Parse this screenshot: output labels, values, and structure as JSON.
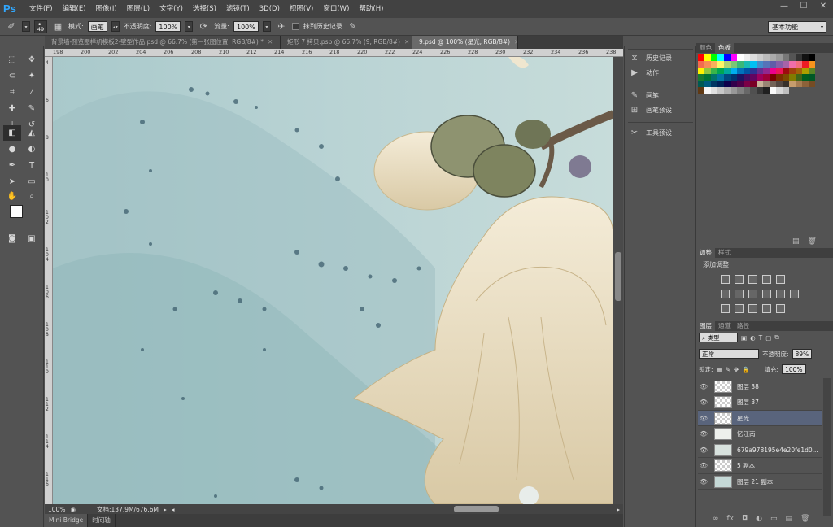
{
  "app": {
    "logo": "Ps"
  },
  "menus": [
    "文件(F)",
    "编辑(E)",
    "图像(I)",
    "图层(L)",
    "文字(Y)",
    "选择(S)",
    "滤镜(T)",
    "3D(D)",
    "视图(V)",
    "窗口(W)",
    "帮助(H)"
  ],
  "window_controls": [
    "—",
    "☐",
    "✕"
  ],
  "options": {
    "brush_size": "49",
    "mode_label": "模式:",
    "mode_value": "画笔",
    "opacity_label": "不透明度:",
    "opacity_value": "100%",
    "flow_label": "流量:",
    "flow_value": "100%",
    "erase_history_label": "抹到历史记录",
    "workspace": "基本功能"
  },
  "doc_tabs": [
    {
      "label": "背景墙-预览图样机模板2-壁型作品.psd @ 66.7% (第一张图位置, RGB/8#) *",
      "active": false
    },
    {
      "label": "矩形 7 拷贝.psb @ 66.7% (9, RGB/8#)",
      "active": false
    },
    {
      "label": "9.psd @ 100% (星光, RGB/8#)",
      "active": true
    }
  ],
  "ruler_top": [
    "198",
    "200",
    "202",
    "204",
    "206",
    "208",
    "210",
    "212",
    "214",
    "216",
    "218",
    "220",
    "222",
    "224",
    "226",
    "228",
    "230",
    "232",
    "234",
    "236",
    "238"
  ],
  "ruler_left": [
    "4",
    "6",
    "8",
    "1\n0",
    "1\n0\n2",
    "1\n0\n4",
    "1\n0\n6",
    "1\n0\n8",
    "1\n1\n0",
    "1\n1\n2",
    "1\n1\n4",
    "1\n1\n6"
  ],
  "status": {
    "zoom": "100%",
    "doc_info": "文档:137.9M/676.6M"
  },
  "bottom_tabs": [
    "Mini Bridge",
    "时间轴"
  ],
  "dock": [
    {
      "icon": "history-icon",
      "glyph": "⧖",
      "label": "历史记录"
    },
    {
      "icon": "actions-icon",
      "glyph": "▶",
      "label": "动作"
    },
    {
      "icon": "brush-icon",
      "glyph": "✎",
      "label": "画笔"
    },
    {
      "icon": "brush-presets-icon",
      "glyph": "⊞",
      "label": "画笔预设"
    },
    {
      "icon": "tool-presets-icon",
      "glyph": "✂",
      "label": "工具预设"
    }
  ],
  "color_panel": {
    "tabs": [
      "颜色",
      "色板"
    ],
    "active": 1
  },
  "adjust_panel": {
    "tabs": [
      "调整",
      "样式"
    ],
    "title": "添加调整"
  },
  "layers_panel": {
    "tabs": [
      "图层",
      "通道",
      "路径"
    ],
    "filter_kind": "类型",
    "blend_mode": "正常",
    "opacity_label": "不透明度:",
    "opacity_value": "89%",
    "lock_label": "锁定:",
    "fill_label": "填充:",
    "fill_value": "100%",
    "layers": [
      {
        "name": "图层 38",
        "selected": false
      },
      {
        "name": "图层 37",
        "selected": false
      },
      {
        "name": "星光",
        "selected": true
      },
      {
        "name": "忆江南",
        "selected": false
      },
      {
        "name": "679a978195e4e20fe1d0...",
        "selected": false
      },
      {
        "name": "5 副本",
        "selected": false
      },
      {
        "name": "图层 21 副本",
        "selected": false
      }
    ]
  }
}
